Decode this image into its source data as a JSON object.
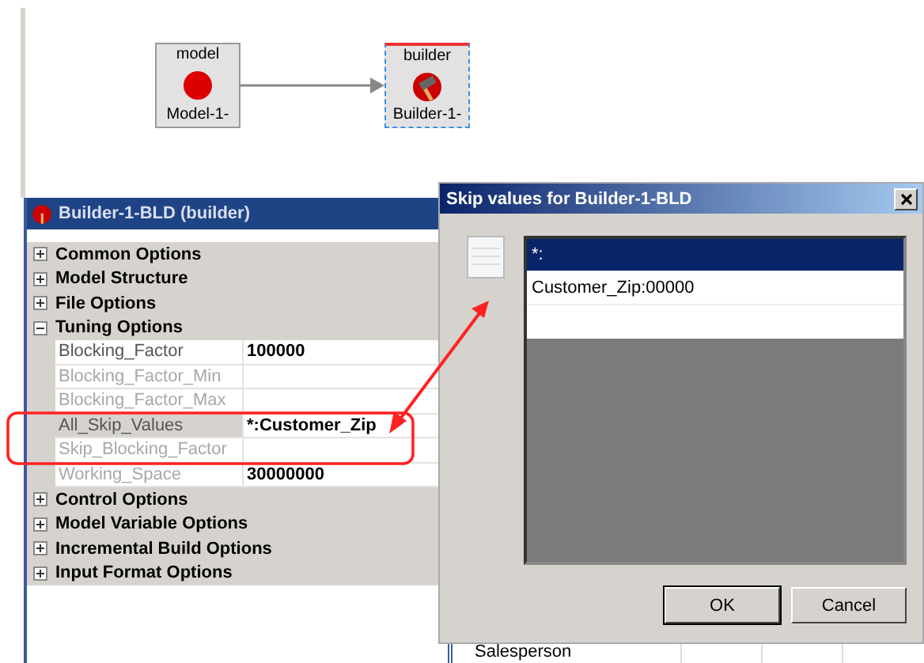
{
  "diagram": {
    "nodes": [
      {
        "kind": "model",
        "type_label": "model",
        "name": "Model-1-",
        "selected": false
      },
      {
        "kind": "builder",
        "type_label": "builder",
        "name": "Builder-1-",
        "selected": true
      }
    ]
  },
  "properties_panel": {
    "title": "Builder-1-BLD (builder)",
    "groups": [
      {
        "name": "Common Options",
        "expanded": false
      },
      {
        "name": "Model Structure",
        "expanded": false
      },
      {
        "name": "File Options",
        "expanded": false
      },
      {
        "name": "Tuning Options",
        "expanded": true,
        "rows": [
          {
            "name": "Blocking_Factor",
            "value": "100000",
            "disabled": false,
            "selected": false
          },
          {
            "name": "Blocking_Factor_Min",
            "disabled": true,
            "selected": false
          },
          {
            "name": "Blocking_Factor_Max",
            "disabled": true,
            "selected": false
          },
          {
            "name": "All_Skip_Values",
            "value": "*:Customer_Zip",
            "disabled": false,
            "selected": true
          },
          {
            "name": "Skip_Blocking_Factor",
            "disabled": true,
            "selected": false
          },
          {
            "name": "Working_Space",
            "value": "30000000",
            "disabled": true,
            "selected": false
          }
        ]
      },
      {
        "name": "Control Options",
        "expanded": false
      },
      {
        "name": "Model Variable Options",
        "expanded": false
      },
      {
        "name": "Incremental Build Options",
        "expanded": false
      },
      {
        "name": "Input Format Options",
        "expanded": false
      }
    ]
  },
  "dialog": {
    "title": "Skip values for Builder-1-BLD",
    "items": [
      {
        "text": "*:",
        "selected": true
      },
      {
        "text": "Customer_Zip:00000",
        "selected": false
      }
    ],
    "buttons": [
      "OK",
      "Cancel"
    ]
  },
  "background_table": {
    "cell": "Salesperson"
  }
}
